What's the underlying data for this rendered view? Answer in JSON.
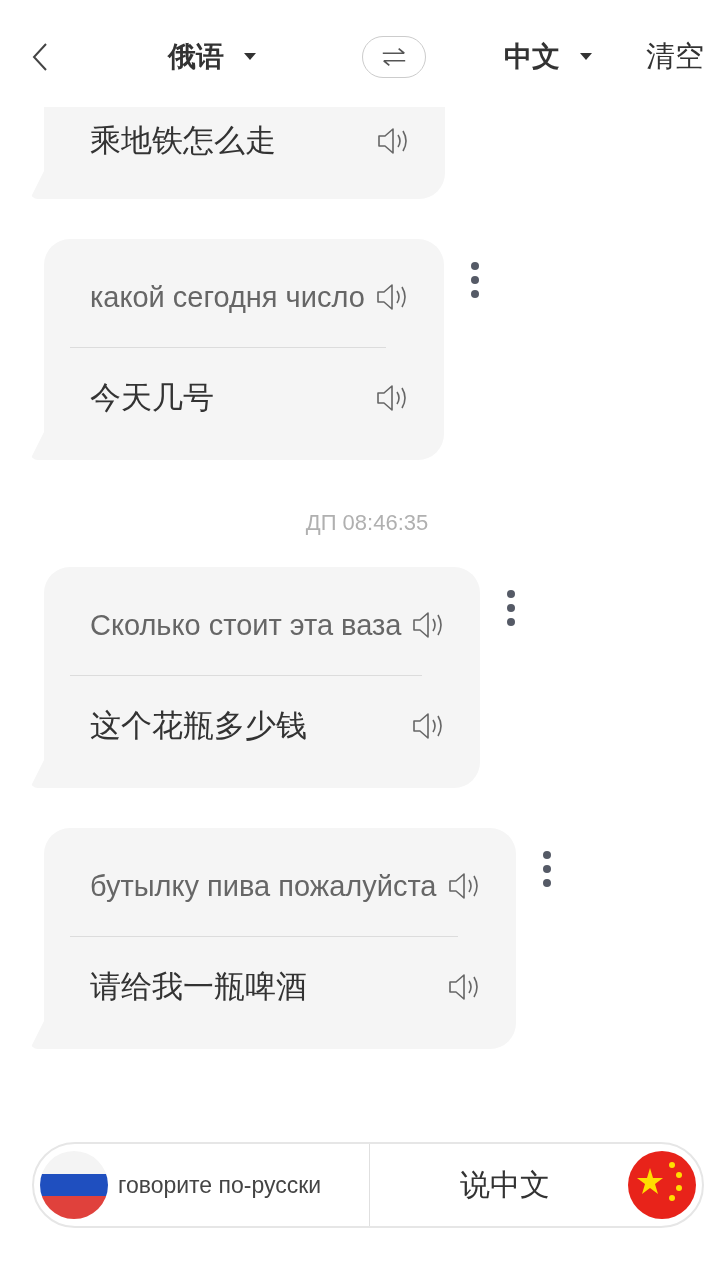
{
  "header": {
    "source_language": "俄语",
    "target_language": "中文",
    "clear": "清空"
  },
  "messages": [
    {
      "kind": "translation_only",
      "translation": "乘地铁怎么走"
    },
    {
      "kind": "pair",
      "source": "какой сегодня число",
      "translation": "今天几号"
    },
    {
      "kind": "time",
      "time": "ДП 08:46:35"
    },
    {
      "kind": "pair",
      "source": "Сколько стоит эта ваза",
      "translation": "这个花瓶多少钱"
    },
    {
      "kind": "pair",
      "source": "бутылку пива пожалуйста",
      "translation": "请给我一瓶啤酒"
    }
  ],
  "bottom_bar": {
    "left_label": "говорите по-русски",
    "right_label": "说中文"
  }
}
